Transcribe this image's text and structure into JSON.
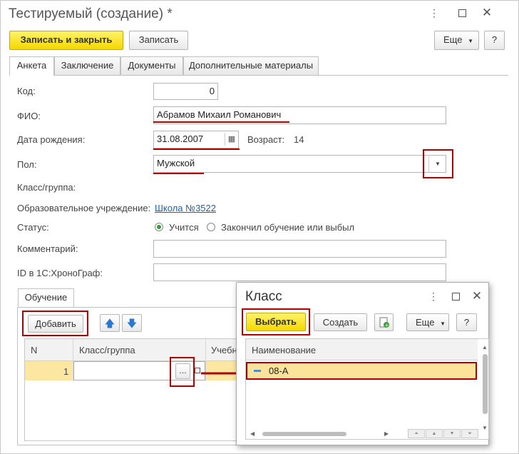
{
  "window": {
    "title": "Тестируемый (создание) *"
  },
  "toolbar": {
    "save_close": "Записать и закрыть",
    "save": "Записать",
    "more": "Еще",
    "help": "?"
  },
  "tabs": [
    "Анкета",
    "Заключение",
    "Документы",
    "Дополнительные материалы"
  ],
  "form": {
    "code_label": "Код:",
    "code_value": "0",
    "fio_label": "ФИО:",
    "fio_value": "Абрамов Михаил Романович",
    "birth_label": "Дата рождения:",
    "birth_value": "31.08.2007",
    "age_label": "Возраст:",
    "age_value": "14",
    "sex_label": "Пол:",
    "sex_value": "Мужской",
    "class_label": "Класс/группа:",
    "school_label": "Образовательное учреждение:",
    "school_value": "Школа №3522",
    "status_label": "Статус:",
    "status_opt1": "Учится",
    "status_opt2": "Закончил обучение или выбыл",
    "comment_label": "Комментарий:",
    "id_label": "ID в 1С:ХроноГраф:"
  },
  "study": {
    "tab": "Обучение",
    "add": "Добавить",
    "col_n": "N",
    "col_class": "Класс/группа",
    "col_edu": "Учебн",
    "row_n": "1",
    "picker": "..."
  },
  "dialog": {
    "title": "Класс",
    "select": "Выбрать",
    "create": "Создать",
    "more": "Еще",
    "help": "?",
    "col_name": "Наименование",
    "row": "08-А"
  },
  "colors": {
    "accent_yellow": "#f5d800",
    "mark_red": "#b00000",
    "selection": "#fbe7a1"
  }
}
